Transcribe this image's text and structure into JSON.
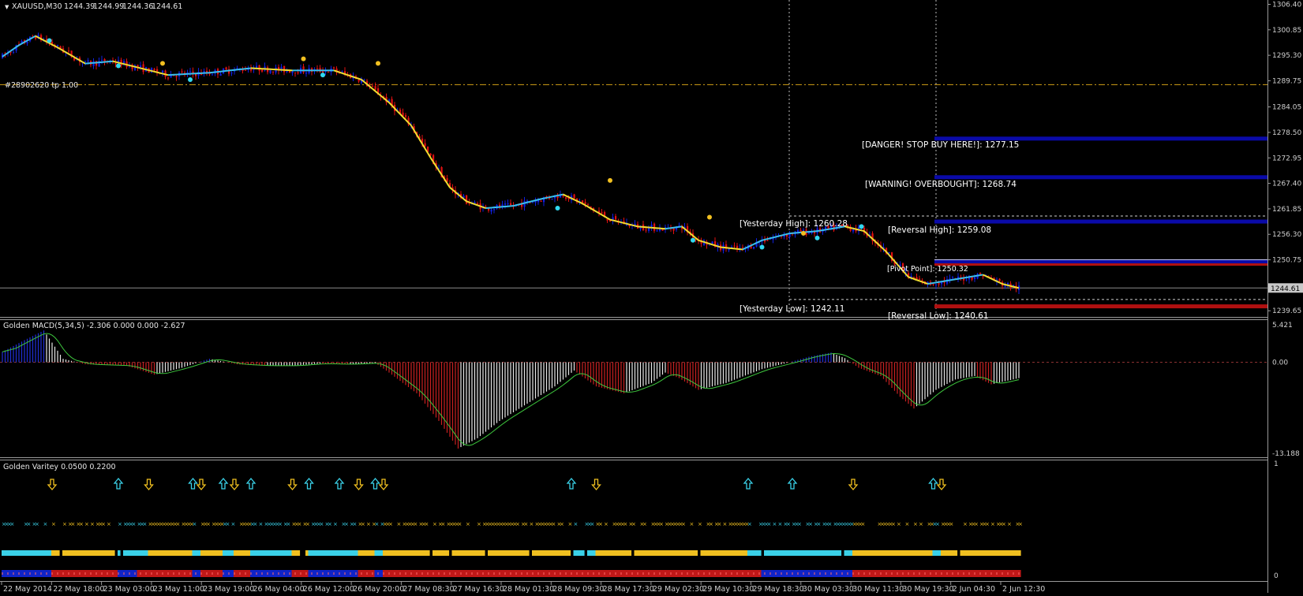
{
  "chart_data": [
    {
      "type": "candlestick",
      "title": "XAUUSD,M30",
      "ohlc_readout": [
        "1244.39",
        "1244.99",
        "1244.36",
        "1244.61"
      ],
      "ylim": [
        1238.65,
        1307.0
      ],
      "yticks": [
        {
          "value": 1306.4,
          "text": "1306.40"
        },
        {
          "value": 1300.85,
          "text": "1300.85"
        },
        {
          "value": 1295.3,
          "text": "1295.30"
        },
        {
          "value": 1289.75,
          "text": "1289.75"
        },
        {
          "value": 1284.05,
          "text": "1284.05"
        },
        {
          "value": 1278.5,
          "text": "1278.50"
        },
        {
          "value": 1272.95,
          "text": "1272.95"
        },
        {
          "value": 1267.4,
          "text": "1267.40"
        },
        {
          "value": 1261.85,
          "text": "1261.85"
        },
        {
          "value": 1256.3,
          "text": "1256.30"
        },
        {
          "value": 1250.75,
          "text": "1250.75"
        },
        {
          "value": 1239.65,
          "text": "1239.65"
        }
      ],
      "current_price": 1244.61,
      "current_price_text": "1244.61",
      "series_path": [
        {
          "bar": 0,
          "price": 1295.0
        },
        {
          "bar": 6,
          "price": 1297.5
        },
        {
          "bar": 12,
          "price": 1299.5
        },
        {
          "bar": 20,
          "price": 1297.0
        },
        {
          "bar": 30,
          "price": 1293.5
        },
        {
          "bar": 40,
          "price": 1294.0
        },
        {
          "bar": 50,
          "price": 1292.5
        },
        {
          "bar": 60,
          "price": 1291.0
        },
        {
          "bar": 75,
          "price": 1291.5
        },
        {
          "bar": 90,
          "price": 1292.5
        },
        {
          "bar": 105,
          "price": 1292.0
        },
        {
          "bar": 120,
          "price": 1292.0
        },
        {
          "bar": 130,
          "price": 1290.0
        },
        {
          "bar": 140,
          "price": 1285.0
        },
        {
          "bar": 148,
          "price": 1280.0
        },
        {
          "bar": 155,
          "price": 1273.0
        },
        {
          "bar": 162,
          "price": 1266.5
        },
        {
          "bar": 168,
          "price": 1263.5
        },
        {
          "bar": 175,
          "price": 1262.0
        },
        {
          "bar": 185,
          "price": 1262.5
        },
        {
          "bar": 195,
          "price": 1264.0
        },
        {
          "bar": 203,
          "price": 1265.0
        },
        {
          "bar": 210,
          "price": 1263.0
        },
        {
          "bar": 220,
          "price": 1259.5
        },
        {
          "bar": 230,
          "price": 1258.0
        },
        {
          "bar": 240,
          "price": 1257.5
        },
        {
          "bar": 246,
          "price": 1258.0
        },
        {
          "bar": 252,
          "price": 1255.0
        },
        {
          "bar": 260,
          "price": 1253.5
        },
        {
          "bar": 268,
          "price": 1253.0
        },
        {
          "bar": 275,
          "price": 1255.0
        },
        {
          "bar": 285,
          "price": 1256.5
        },
        {
          "bar": 295,
          "price": 1257.0
        },
        {
          "bar": 305,
          "price": 1258.0
        },
        {
          "bar": 312,
          "price": 1257.0
        },
        {
          "bar": 320,
          "price": 1252.5
        },
        {
          "bar": 328,
          "price": 1247.0
        },
        {
          "bar": 335,
          "price": 1245.5
        },
        {
          "bar": 345,
          "price": 1246.5
        },
        {
          "bar": 355,
          "price": 1247.5
        },
        {
          "bar": 362,
          "price": 1245.5
        },
        {
          "bar": 368,
          "price": 1244.6
        }
      ],
      "swing_markers": [
        {
          "bar": 58,
          "price": 1292.5,
          "kind": "high"
        },
        {
          "bar": 109,
          "price": 1293.5,
          "kind": "high"
        },
        {
          "bar": 136,
          "price": 1292.5,
          "kind": "high"
        },
        {
          "bar": 68,
          "price": 1290.0,
          "kind": "low"
        },
        {
          "bar": 116,
          "price": 1291.0,
          "kind": "low"
        },
        {
          "bar": 220,
          "price": 1267.0,
          "kind": "high"
        },
        {
          "bar": 256,
          "price": 1259.0,
          "kind": "high"
        },
        {
          "bar": 201,
          "price": 1262.0,
          "kind": "low"
        },
        {
          "bar": 250,
          "price": 1255.0,
          "kind": "low"
        },
        {
          "bar": 275,
          "price": 1253.5,
          "kind": "low"
        },
        {
          "bar": 290,
          "price": 1255.5,
          "kind": "high"
        },
        {
          "bar": 295,
          "price": 1255.5,
          "kind": "low"
        },
        {
          "bar": 311,
          "price": 1258.0,
          "kind": "low"
        },
        {
          "bar": 17,
          "price": 1298.5,
          "kind": "low"
        },
        {
          "bar": 42,
          "price": 1293.0,
          "kind": "low"
        }
      ],
      "levels": [
        {
          "label": "[DANGER! STOP BUY HERE!]: 1277.15",
          "price": 1277.15,
          "color": "#0a0aa8"
        },
        {
          "label": "[WARNING! OVERBOUGHT]: 1268.74",
          "price": 1268.74,
          "color": "#0a0aa8"
        },
        {
          "label": "[Reversal High]: 1259.08",
          "price": 1259.08,
          "color": "#0a0aa8"
        },
        {
          "label": "[Reversal Low]: 1240.61",
          "price": 1240.61,
          "color": "#b01010"
        }
      ],
      "yesterday_high": {
        "label": "[Yesterday High]: 1260.28",
        "price": 1260.28
      },
      "yesterday_low": {
        "label": "[Yesterday Low]: 1242.11",
        "price": 1242.11
      },
      "overlapping_label": "[Pivot Point]: 1250.32",
      "trade_line": {
        "label": "#28902620 tp",
        "volume": "1.00",
        "price": 1288.9,
        "color": "#d4a017"
      }
    },
    {
      "type": "histogram",
      "title": "Golden MACD(5,34,5) -2.306 0.000 0.000 -2.627",
      "ylim": [
        -13.188,
        5.421
      ],
      "yticks": [
        {
          "value": 5.421,
          "text": "5.421"
        },
        {
          "value": 0.0,
          "text": "0.00"
        },
        {
          "value": -13.188,
          "text": "-13.188"
        }
      ],
      "histogram_path": [
        {
          "bar": 0,
          "value": 1.5
        },
        {
          "bar": 8,
          "value": 3.2
        },
        {
          "bar": 15,
          "value": 4.6
        },
        {
          "bar": 22,
          "value": 0.5
        },
        {
          "bar": 30,
          "value": -0.3
        },
        {
          "bar": 45,
          "value": -0.5
        },
        {
          "bar": 55,
          "value": -1.8
        },
        {
          "bar": 65,
          "value": -0.8
        },
        {
          "bar": 75,
          "value": 0.5
        },
        {
          "bar": 85,
          "value": -0.3
        },
        {
          "bar": 95,
          "value": -0.5
        },
        {
          "bar": 105,
          "value": -0.5
        },
        {
          "bar": 115,
          "value": -0.2
        },
        {
          "bar": 125,
          "value": -0.3
        },
        {
          "bar": 135,
          "value": -0.1
        },
        {
          "bar": 140,
          "value": -1.5
        },
        {
          "bar": 150,
          "value": -4.5
        },
        {
          "bar": 158,
          "value": -8.5
        },
        {
          "bar": 165,
          "value": -12.5
        },
        {
          "bar": 172,
          "value": -11.0
        },
        {
          "bar": 180,
          "value": -8.5
        },
        {
          "bar": 190,
          "value": -6.0
        },
        {
          "bar": 200,
          "value": -3.5
        },
        {
          "bar": 207,
          "value": -1.2
        },
        {
          "bar": 215,
          "value": -3.5
        },
        {
          "bar": 225,
          "value": -4.5
        },
        {
          "bar": 235,
          "value": -3.0
        },
        {
          "bar": 240,
          "value": -1.5
        },
        {
          "bar": 245,
          "value": -2.3
        },
        {
          "bar": 252,
          "value": -4.0
        },
        {
          "bar": 262,
          "value": -3.0
        },
        {
          "bar": 275,
          "value": -1.0
        },
        {
          "bar": 285,
          "value": 0.0
        },
        {
          "bar": 292,
          "value": 0.8
        },
        {
          "bar": 300,
          "value": 1.4
        },
        {
          "bar": 305,
          "value": 0.6
        },
        {
          "bar": 310,
          "value": -0.8
        },
        {
          "bar": 318,
          "value": -2.0
        },
        {
          "bar": 325,
          "value": -5.0
        },
        {
          "bar": 330,
          "value": -6.7
        },
        {
          "bar": 338,
          "value": -4.0
        },
        {
          "bar": 345,
          "value": -2.5
        },
        {
          "bar": 352,
          "value": -2.0
        },
        {
          "bar": 358,
          "value": -3.2
        },
        {
          "bar": 368,
          "value": -2.3
        }
      ]
    },
    {
      "type": "signal-rows",
      "title": "Golden Varitey 0.0500 0.2200",
      "yticks": [
        {
          "value": 1,
          "text": "1"
        },
        {
          "value": 0,
          "text": "0"
        }
      ],
      "arrows": [
        {
          "bar": 18,
          "dir": "down"
        },
        {
          "bar": 42,
          "dir": "up"
        },
        {
          "bar": 53,
          "dir": "down"
        },
        {
          "bar": 69,
          "dir": "up"
        },
        {
          "bar": 72,
          "dir": "down"
        },
        {
          "bar": 80,
          "dir": "up"
        },
        {
          "bar": 84,
          "dir": "down"
        },
        {
          "bar": 90,
          "dir": "up"
        },
        {
          "bar": 105,
          "dir": "down"
        },
        {
          "bar": 111,
          "dir": "up"
        },
        {
          "bar": 122,
          "dir": "up"
        },
        {
          "bar": 129,
          "dir": "down"
        },
        {
          "bar": 135,
          "dir": "up"
        },
        {
          "bar": 138,
          "dir": "down"
        },
        {
          "bar": 206,
          "dir": "up"
        },
        {
          "bar": 215,
          "dir": "down"
        },
        {
          "bar": 270,
          "dir": "up"
        },
        {
          "bar": 286,
          "dir": "up"
        },
        {
          "bar": 308,
          "dir": "down"
        },
        {
          "bar": 337,
          "dir": "up"
        },
        {
          "bar": 340,
          "dir": "down"
        }
      ],
      "colors": {
        "up": "#3ad1e8",
        "down": "#f0c020",
        "bull": "#1024c8",
        "bear": "#c01818"
      }
    }
  ],
  "time_axis": [
    "22 May 2014",
    "22 May 18:00",
    "23 May 03:00",
    "23 May 11:00",
    "23 May 19:00",
    "26 May 04:00",
    "26 May 12:00",
    "26 May 20:00",
    "27 May 08:30",
    "27 May 16:30",
    "28 May 01:30",
    "28 May 09:30",
    "28 May 17:30",
    "29 May 02:30",
    "29 May 10:30",
    "29 May 18:30",
    "30 May 03:30",
    "30 May 11:30",
    "30 May 19:30",
    "2 Jun 04:30",
    "2 Jun 12:30"
  ],
  "bars_shown": 368
}
